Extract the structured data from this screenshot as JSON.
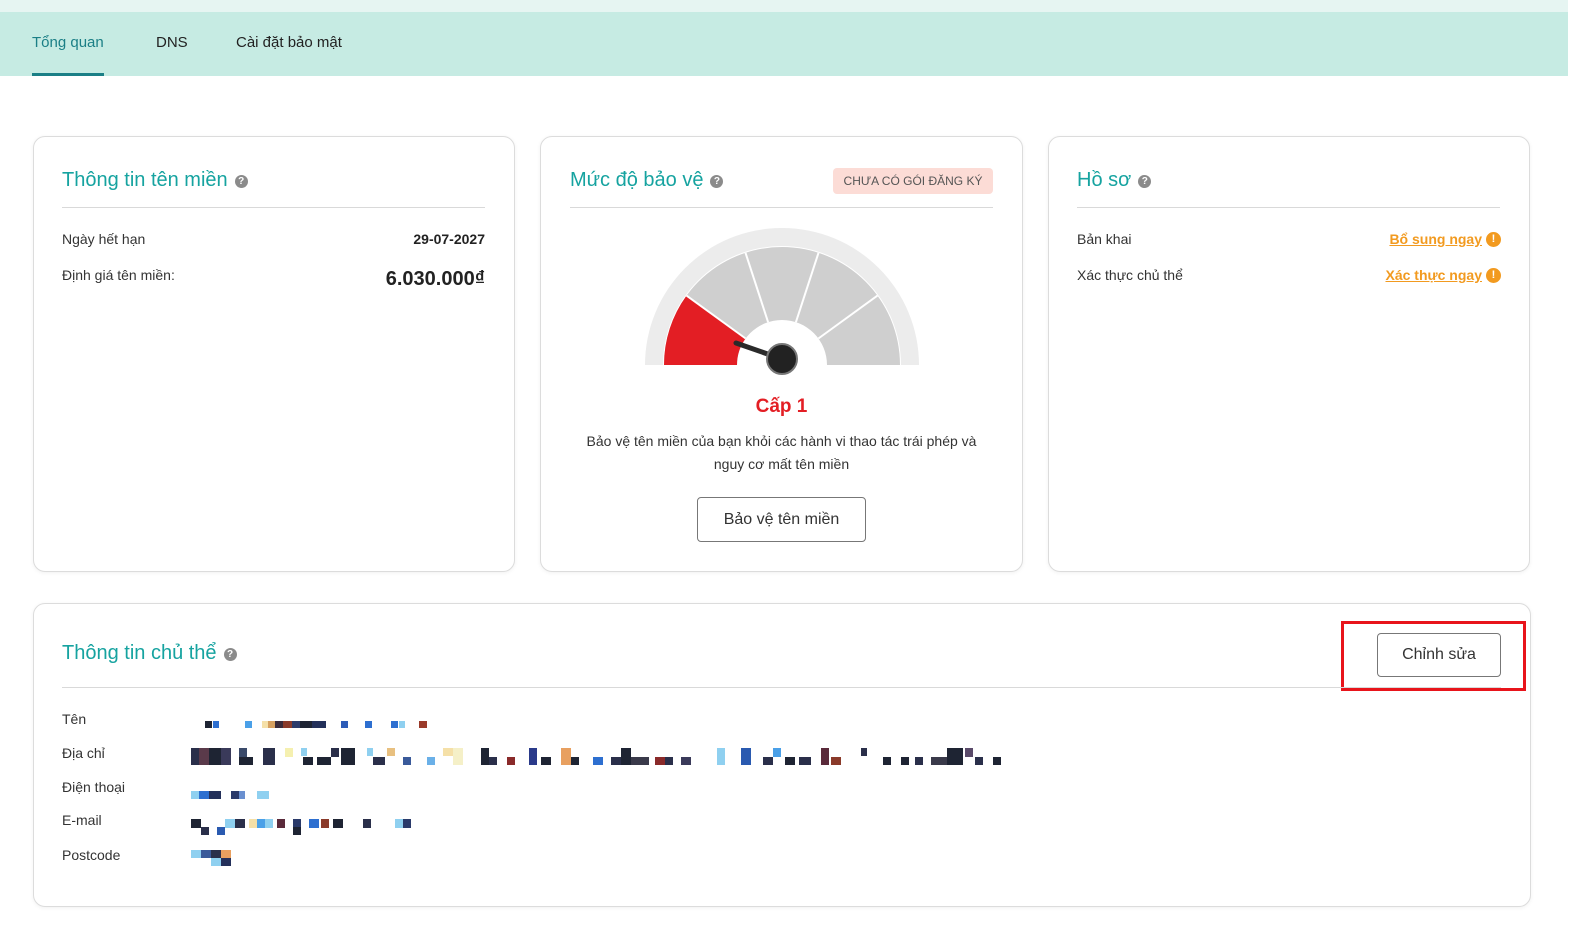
{
  "tabs": [
    {
      "label": "Tổng quan",
      "active": true
    },
    {
      "label": "DNS",
      "active": false
    },
    {
      "label": "Cài đặt bảo mật",
      "active": false
    }
  ],
  "domain_info": {
    "title": "Thông tin tên miền",
    "rows": [
      {
        "label": "Ngày hết hạn",
        "value": "29-07-2027"
      },
      {
        "label": "Định giá tên miền:",
        "value": "6.030.000₫"
      }
    ]
  },
  "protection": {
    "title": "Mức độ bảo vệ",
    "badge": "CHƯA CÓ GÓI ĐĂNG KÝ",
    "level_label": "Cấp 1",
    "level": 1,
    "level_max": 5,
    "description": "Bảo vệ tên miền của bạn khỏi các hành vi thao tác trái phép và nguy cơ mất tên miền",
    "button": "Bảo vệ tên miền"
  },
  "profile": {
    "title": "Hồ sơ",
    "rows": [
      {
        "label": "Bản khai",
        "action": "Bổ sung ngay"
      },
      {
        "label": "Xác thực chủ thể",
        "action": "Xác thực ngay"
      }
    ]
  },
  "owner": {
    "title": "Thông tin chủ thể",
    "edit_button": "Chỉnh sửa",
    "rows": [
      {
        "label": "Tên"
      },
      {
        "label": "Địa chỉ"
      },
      {
        "label": "Điện thoại"
      },
      {
        "label": "E-mail"
      },
      {
        "label": "Postcode"
      }
    ]
  },
  "colors": {
    "accent": "#16a3a0",
    "tab_bg": "#c6ebe3",
    "gauge_red": "#e31e24",
    "warning": "#f29a1f",
    "highlight": "#e8141b"
  }
}
